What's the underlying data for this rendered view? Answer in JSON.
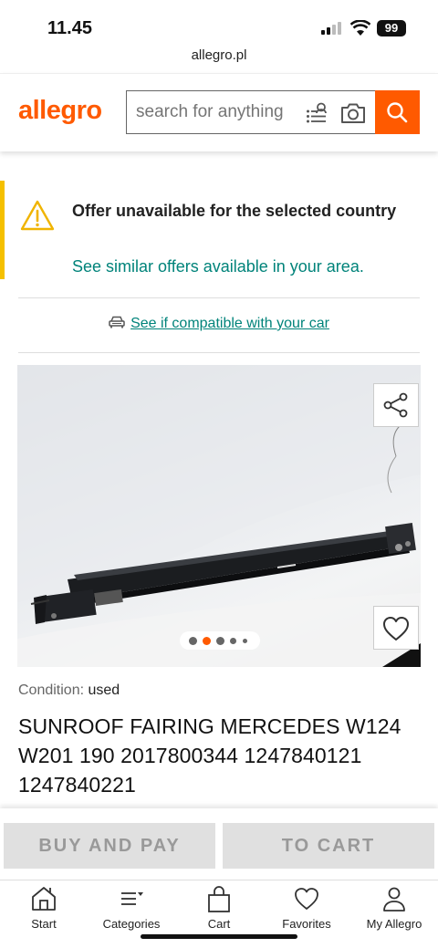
{
  "status_bar": {
    "time": "11.45",
    "battery": "99"
  },
  "browser": {
    "url": "allegro.pl"
  },
  "header": {
    "logo": "allegro",
    "search_placeholder": "search for anything",
    "brand_color": "#ff5a00"
  },
  "alert": {
    "title": "Offer unavailable for the selected country",
    "link": "See similar offers available in your area.",
    "accent_color": "#f5c000",
    "link_color": "#00837a"
  },
  "compatibility": {
    "link": "See if compatible with your car"
  },
  "gallery": {
    "image_count": 5,
    "active_index": 1,
    "share_icon": "share-icon",
    "favorite_icon": "heart-icon"
  },
  "product": {
    "condition_label": "Condition:",
    "condition_value": "used",
    "title": "SUNROOF FAIRING MERCEDES W124 W201 190 2017800344 1247840121 1247840221"
  },
  "actions": {
    "buy_label": "BUY AND PAY",
    "cart_label": "TO CART"
  },
  "bottom_nav": [
    {
      "label": "Start",
      "icon": "home-icon"
    },
    {
      "label": "Categories",
      "icon": "menu-icon"
    },
    {
      "label": "Cart",
      "icon": "bag-icon"
    },
    {
      "label": "Favorites",
      "icon": "heart-icon"
    },
    {
      "label": "My Allegro",
      "icon": "user-icon"
    }
  ]
}
